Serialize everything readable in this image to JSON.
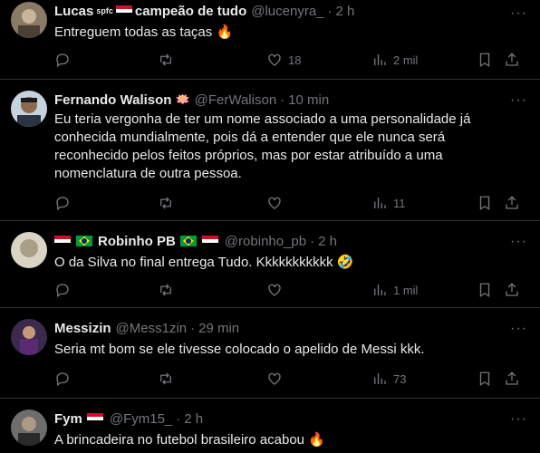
{
  "tweets": [
    {
      "name": "Lucas",
      "badge": "spfc",
      "name_suffix": "campeão de tudo",
      "handle": "@lucenyra_",
      "time": "2 h",
      "text": "Entreguem todas as taças",
      "emoji": "🔥",
      "reply_count": "",
      "retweet_count": "",
      "like_count": "18",
      "view_count": "2 mil"
    },
    {
      "name": "Fernando Walison",
      "name_emoji": "🪷",
      "handle": "@FerWalison",
      "time": "10 min",
      "text_lines": [
        "Eu teria vergonha de ter um nome associado a uma personalidade já",
        "conhecida mundialmente, pois dá a entender que ele nunca será",
        "reconhecido pelos feitos próprios, mas por estar atribuído a uma",
        "nomenclatura de outra pessoa."
      ],
      "view_count": "11"
    },
    {
      "name": "Robinho PB",
      "handle": "@robinho_pb",
      "time": "2 h",
      "text": "O da Silva no final entrega Tudo. Kkkkkkkkkkk",
      "emoji": "🤣",
      "view_count": "1 mil"
    },
    {
      "name": "Messizin",
      "handle": "@Mess1zin",
      "time": "29 min",
      "text": "Seria mt bom se ele tivesse colocado o apelido de Messi kkk.",
      "view_count": "73"
    },
    {
      "name": "Fym",
      "handle": "@Fym15_",
      "time": "2 h",
      "text": "A brincadeira no futebol brasileiro acabou",
      "emoji": "🔥"
    }
  ],
  "separator": "·",
  "more_glyph": "···",
  "colors": {
    "background": "#000000",
    "text": "#e7e9ea",
    "muted": "#71767b",
    "divider": "#2f3336"
  }
}
